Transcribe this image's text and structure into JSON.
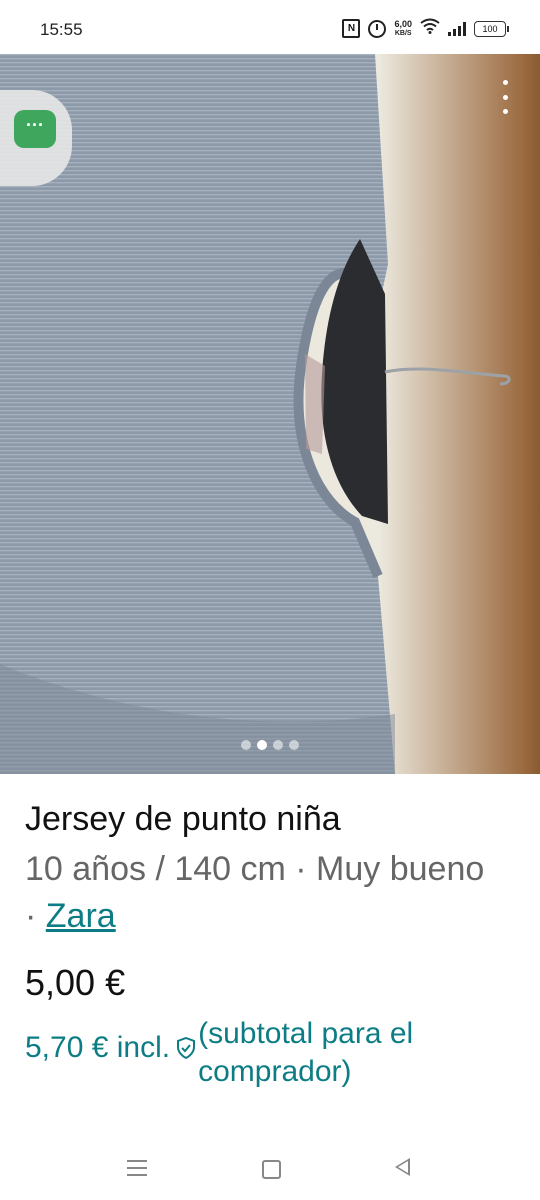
{
  "status_bar": {
    "time": "15:55",
    "nfc_label": "N",
    "speed_value": "6,00",
    "speed_unit": "KB/S",
    "battery": "100"
  },
  "photo": {
    "slide_count": 4,
    "active_slide": 2,
    "more_icon": "more-vertical-icon",
    "back_icon": "back-arrow-icon",
    "chat_icon": "chat-bubble-icon",
    "bubble_text": "···"
  },
  "listing": {
    "title": "Jersey de punto niña",
    "details": "10 años / 140 cm · Muy bueno · ",
    "brand": "Zara",
    "price": "5,00 €",
    "buyer_price": "5,70 € incl.",
    "buyer_note": "(subtotal para el comprador)"
  },
  "colors": {
    "accent": "#0d7d85",
    "chat_green": "#3fa65d"
  }
}
